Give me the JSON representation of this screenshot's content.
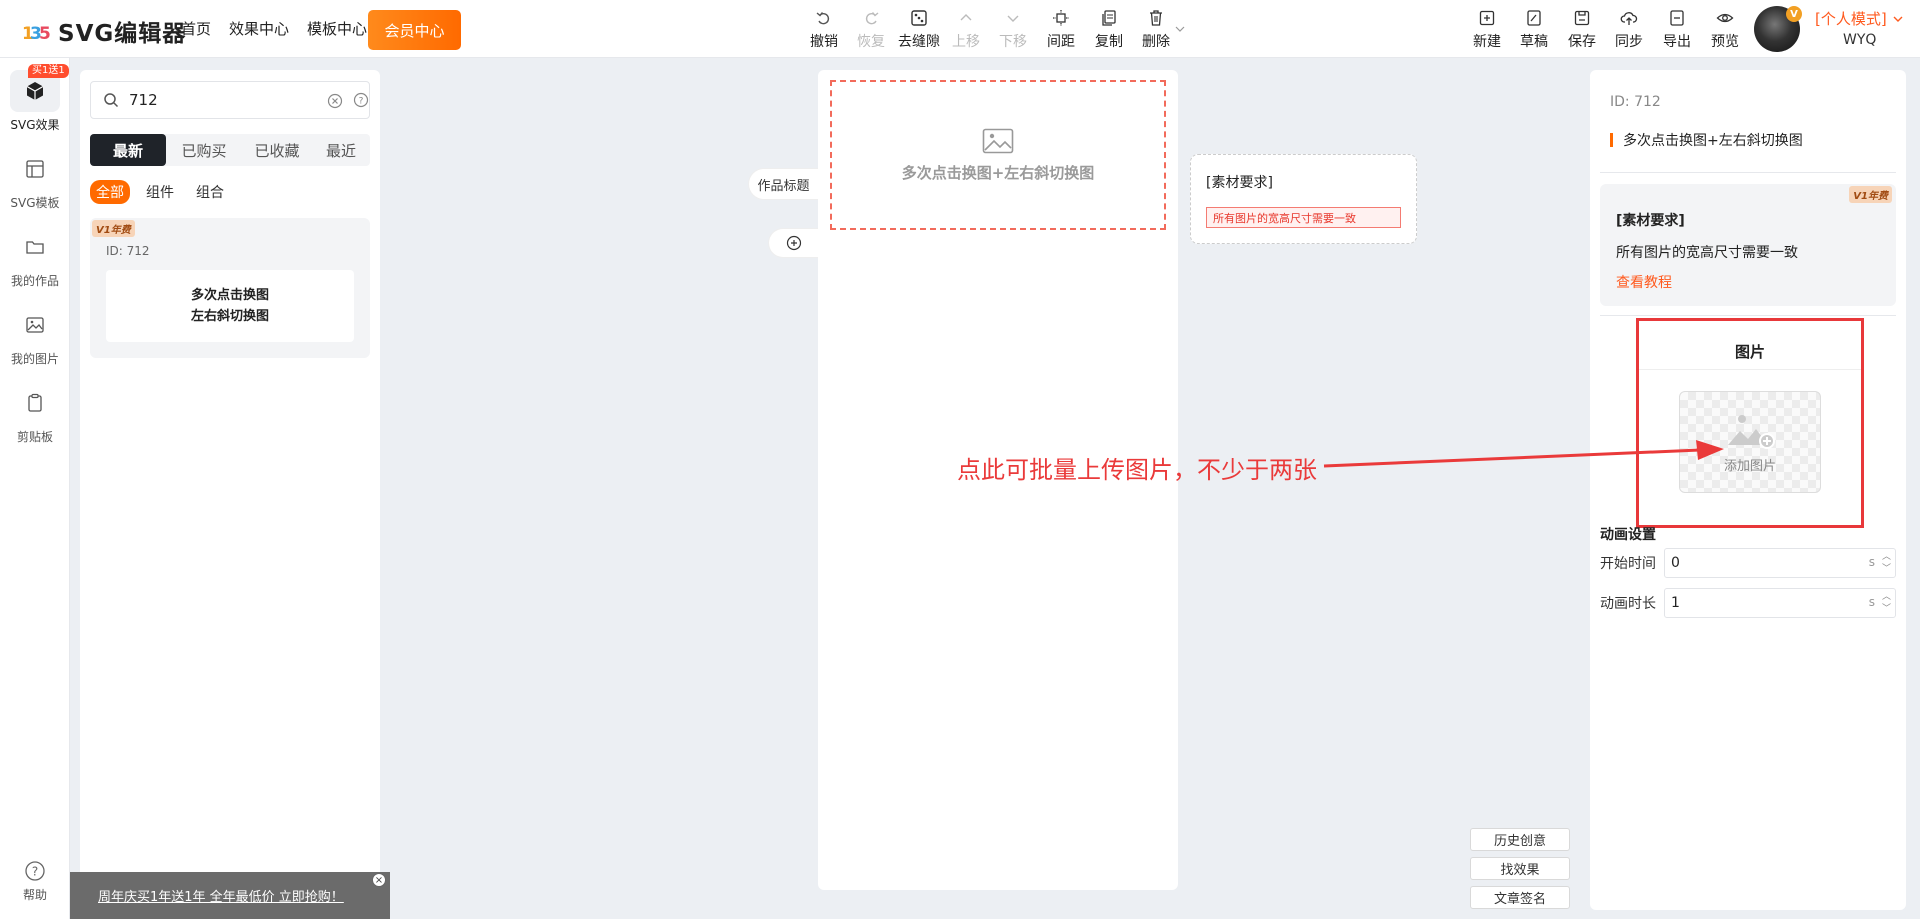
{
  "header": {
    "logo_text": "SVG编辑器",
    "nav": [
      "首页",
      "效果中心",
      "模板中心"
    ],
    "vip_label": "会员中心",
    "tools": {
      "undo": "撤销",
      "redo": "恢复",
      "remove_gap": "去缝隙",
      "move_up": "上移",
      "move_down": "下移",
      "spacing": "间距",
      "copy": "复制",
      "delete": "删除"
    },
    "right_tools": {
      "new": "新建",
      "draft": "草稿",
      "save": "保存",
      "sync": "同步",
      "export": "导出",
      "preview": "预览"
    },
    "mode_label": "[个人模式]",
    "avatar_badge": "V",
    "user_name": "WYQ"
  },
  "rail": {
    "badge": "买1送1",
    "items": [
      "SVG效果",
      "SVG模板",
      "我的作品",
      "我的图片",
      "剪贴板"
    ],
    "help": "帮助"
  },
  "panel": {
    "search_value": "712",
    "tabs": [
      "最新",
      "已购买",
      "已收藏",
      "最近"
    ],
    "filters": [
      "全部",
      "组件",
      "组合"
    ],
    "card": {
      "badge": "V1年费",
      "id": "ID: 712",
      "line1": "多次点击换图",
      "line2": "左右斜切换图"
    },
    "promo": "周年庆买1年送1年 全年最低价 立即抢购！"
  },
  "canvas": {
    "title_chip": "作品标题",
    "placeholder_text": "多次点击换图+左右斜切换图",
    "req_title": "[素材要求]",
    "req_warning": "所有图片的宽高尺寸需要一致",
    "annotation": "点此可批量上传图片，不少于两张",
    "side_buttons": [
      "历史创意",
      "找效果",
      "文章签名"
    ]
  },
  "right_panel": {
    "id": "ID: 712",
    "title": "多次点击换图+左右斜切换图",
    "req_badge": "V1年费",
    "req_heading": "[素材要求]",
    "req_desc": "所有图片的宽高尺寸需要一致",
    "tutorial_link": "查看教程",
    "image_section": "图片",
    "add_image": "添加图片",
    "anim_heading": "动画设置",
    "start_time_label": "开始时间",
    "start_time_value": "0",
    "duration_label": "动画时长",
    "duration_value": "1",
    "unit": "s"
  },
  "colors": {
    "accent": "#ff6a00",
    "annotation": "#ea3a3a",
    "dark_tab": "#1f2329"
  }
}
